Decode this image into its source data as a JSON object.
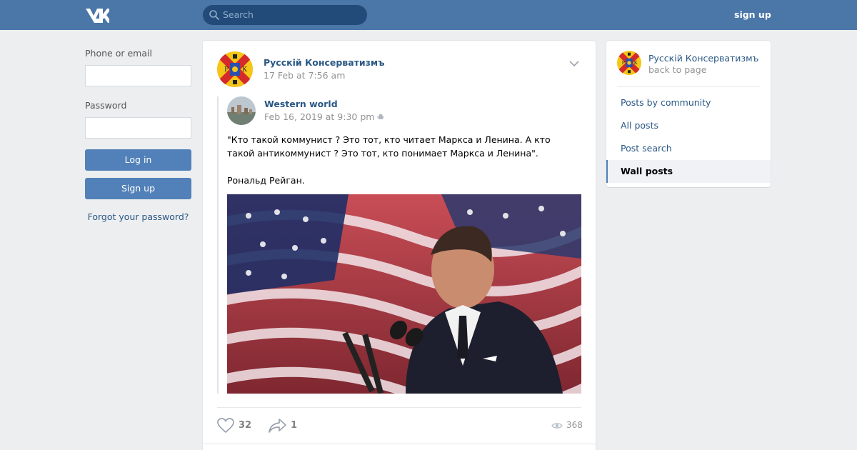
{
  "header": {
    "logo": "vk-logo",
    "search_placeholder": "Search",
    "signup_label": "sign up"
  },
  "login": {
    "phone_label": "Phone or email",
    "phone_value": "",
    "password_label": "Password",
    "password_value": "",
    "login_button": "Log in",
    "signup_button": "Sign up",
    "forgot_link": "Forgot your password?"
  },
  "post": {
    "author": "Русскій Консерватизмъ",
    "date": "17 Feb at 7:56 am",
    "repost": {
      "author": "Western world",
      "date": "Feb 16, 2019 at 9:30 pm",
      "platform_icon": "android-icon",
      "text_lines": [
        "\"Кто такой коммунист ? Это тот, кто читает Маркса и Ленина. А кто такой антикоммунист ? Это тот, кто понимает Маркса и Ленина\".",
        "",
        "Рональд Рейган."
      ]
    },
    "likes": "32",
    "shares": "1",
    "views": "368"
  },
  "side": {
    "name": "Русскій Консерватизмъ",
    "back": "back to page",
    "items": [
      {
        "label": "Posts by community",
        "active": false
      },
      {
        "label": "All posts",
        "active": false
      },
      {
        "label": "Post search",
        "active": false
      },
      {
        "label": "Wall posts",
        "active": true
      }
    ]
  },
  "colors": {
    "header_bg": "#4a76a8",
    "button_bg": "#5181b8",
    "link": "#2a5885",
    "page_bg": "#edeef0"
  }
}
